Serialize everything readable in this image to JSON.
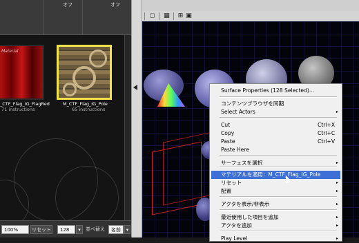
{
  "filter": {
    "col1_value": "オフ",
    "col2_value": "オフ"
  },
  "assets": [
    {
      "name": "M_CTF_Flag_IG_FlagRed",
      "name_visible": "_CTF_Flag_IG_FlagRed",
      "instructions": "71 instructions",
      "texture_text": "Material"
    },
    {
      "name": "M_CTF_Flag_IG_Pole",
      "instructions": "65 instructions"
    }
  ],
  "bottombar": {
    "zoom": "100%",
    "reset_label": "リセット",
    "size": "128",
    "sort_label": "並べ替え",
    "sort_value": "名前"
  },
  "context_menu": {
    "items": [
      {
        "label": "Surface Properties (128 Selected)...",
        "shortcut": "",
        "submenu": false,
        "highlighted": false
      },
      {
        "label": "コンテンツブラウザを同期",
        "shortcut": "",
        "submenu": false,
        "highlighted": false
      },
      {
        "label": "Select Actors",
        "shortcut": "",
        "submenu": true,
        "highlighted": false
      },
      {
        "label": "Cut",
        "shortcut": "Ctrl+X",
        "submenu": false,
        "highlighted": false
      },
      {
        "label": "Copy",
        "shortcut": "Ctrl+C",
        "submenu": false,
        "highlighted": false
      },
      {
        "label": "Paste",
        "shortcut": "Ctrl+V",
        "submenu": false,
        "highlighted": false
      },
      {
        "label": "Paste Here",
        "shortcut": "",
        "submenu": false,
        "highlighted": false
      },
      {
        "label": "サーフェスを選択",
        "shortcut": "",
        "submenu": true,
        "highlighted": false
      },
      {
        "label": "マテリアルを適用：M_CTF_Flag_IG_Pole",
        "shortcut": "",
        "submenu": false,
        "highlighted": true
      },
      {
        "label": "リセット",
        "shortcut": "",
        "submenu": true,
        "highlighted": false
      },
      {
        "label": "配置",
        "shortcut": "",
        "submenu": true,
        "highlighted": false
      },
      {
        "label": "アクタを表示/非表示",
        "shortcut": "",
        "submenu": true,
        "highlighted": false
      },
      {
        "label": "最近使用した項目を追加",
        "shortcut": "",
        "submenu": true,
        "highlighted": false
      },
      {
        "label": "アクタを追加",
        "shortcut": "",
        "submenu": true,
        "highlighted": false
      },
      {
        "label": "Play Level",
        "shortcut": "",
        "submenu": true,
        "highlighted": false
      }
    ]
  },
  "icons": {
    "submenu_arrow": "▸",
    "dropdown_arrow": "▾",
    "collapse_arrow": "◂"
  },
  "colors": {
    "highlight": "#3d6fd6",
    "selection_border": "#f2e34a"
  }
}
